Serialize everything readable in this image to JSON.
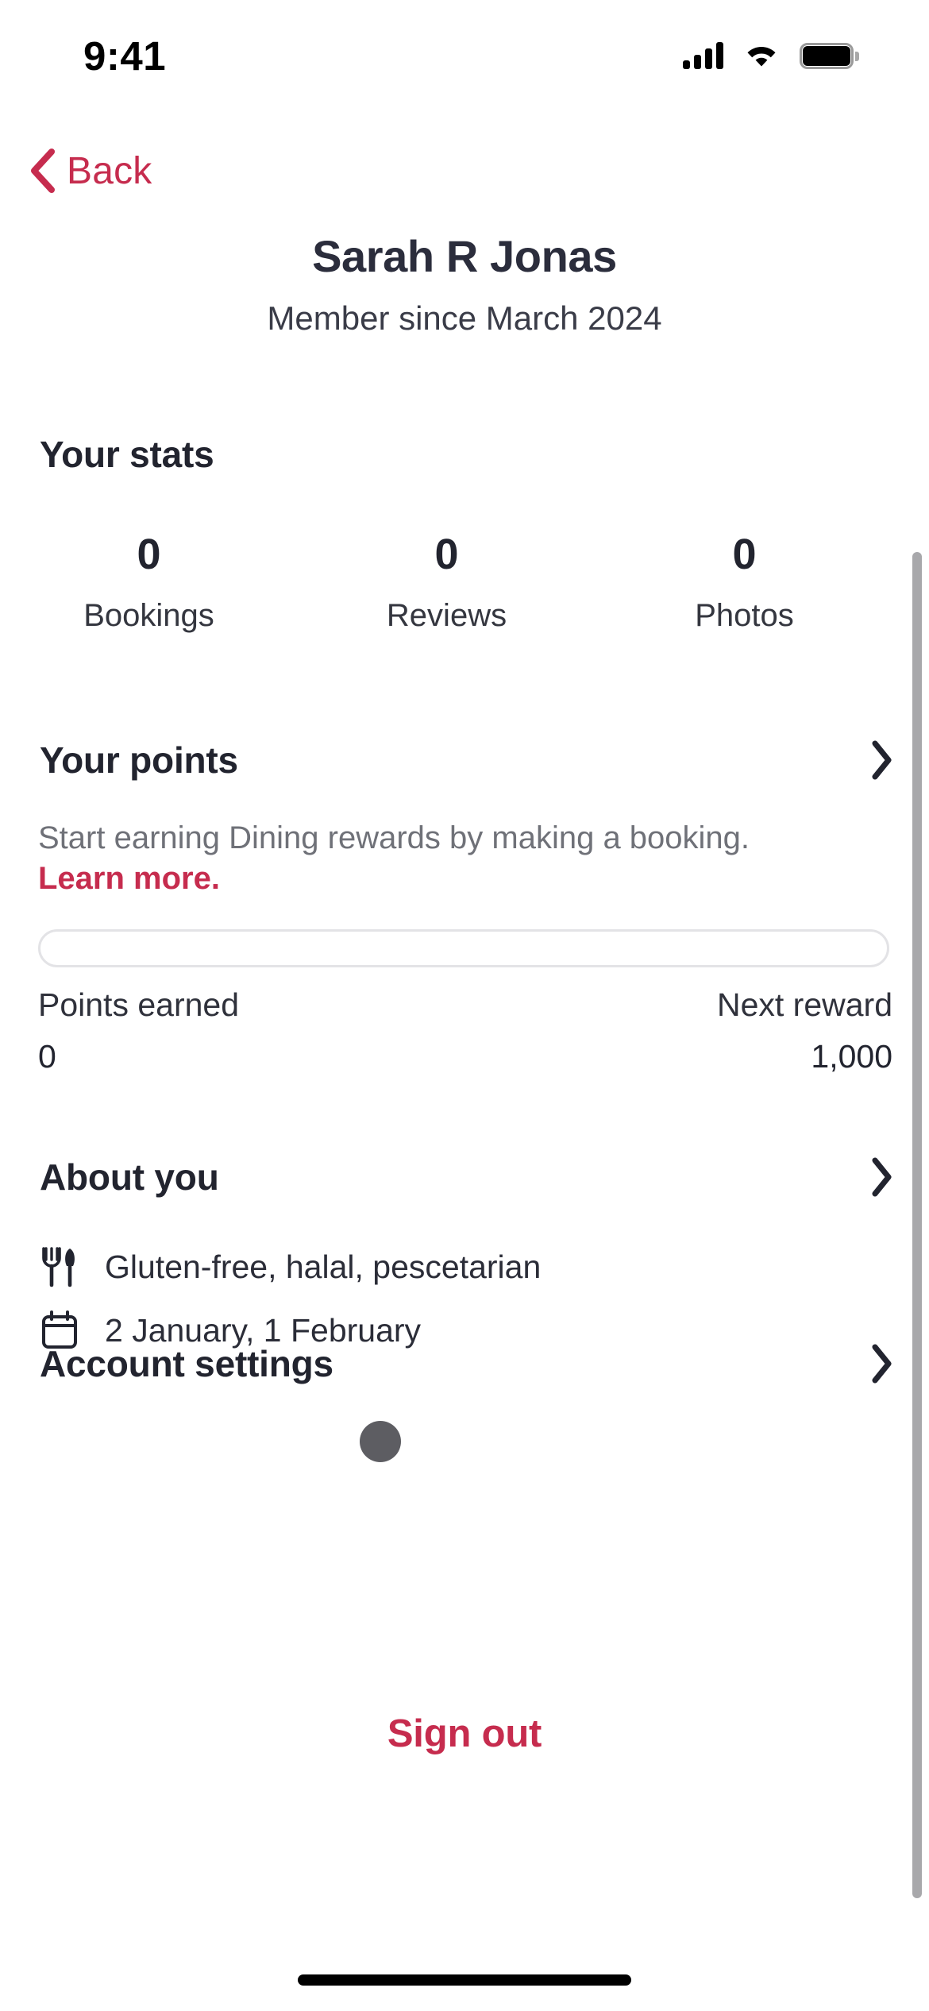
{
  "status_bar": {
    "time": "9:41",
    "cellular_icon": "cellular-signal-icon",
    "wifi_icon": "wifi-icon",
    "battery_icon": "battery-full-icon"
  },
  "nav": {
    "back_label": "Back",
    "back_icon": "chevron-left-icon"
  },
  "profile": {
    "name": "Sarah R Jonas",
    "member_since": "Member since March 2024"
  },
  "stats": {
    "title": "Your stats",
    "items": [
      {
        "value": "0",
        "label": "Bookings"
      },
      {
        "value": "0",
        "label": "Reviews"
      },
      {
        "value": "0",
        "label": "Photos"
      }
    ]
  },
  "points": {
    "title": "Your points",
    "chevron_icon": "chevron-right-icon",
    "description": "Start earning Dining rewards by making a booking.",
    "learn_more": "Learn more.",
    "progress_percent": 0,
    "earned_label": "Points earned",
    "earned_value": "0",
    "next_label": "Next reward",
    "next_value": "1,000"
  },
  "about": {
    "title": "About you",
    "chevron_icon": "chevron-right-icon",
    "items": [
      {
        "icon": "cutlery-icon",
        "text": "Gluten-free, halal, pescetarian"
      },
      {
        "icon": "calendar-icon",
        "text": "2 January, 1 February"
      }
    ]
  },
  "account_settings": {
    "title": "Account settings",
    "chevron_icon": "chevron-right-icon"
  },
  "sign_out": {
    "label": "Sign out"
  },
  "colors": {
    "accent": "#c62c4e",
    "text_dark": "#22242f",
    "text_muted": "#6f7178",
    "scrollbar": "#a8a8ab"
  }
}
